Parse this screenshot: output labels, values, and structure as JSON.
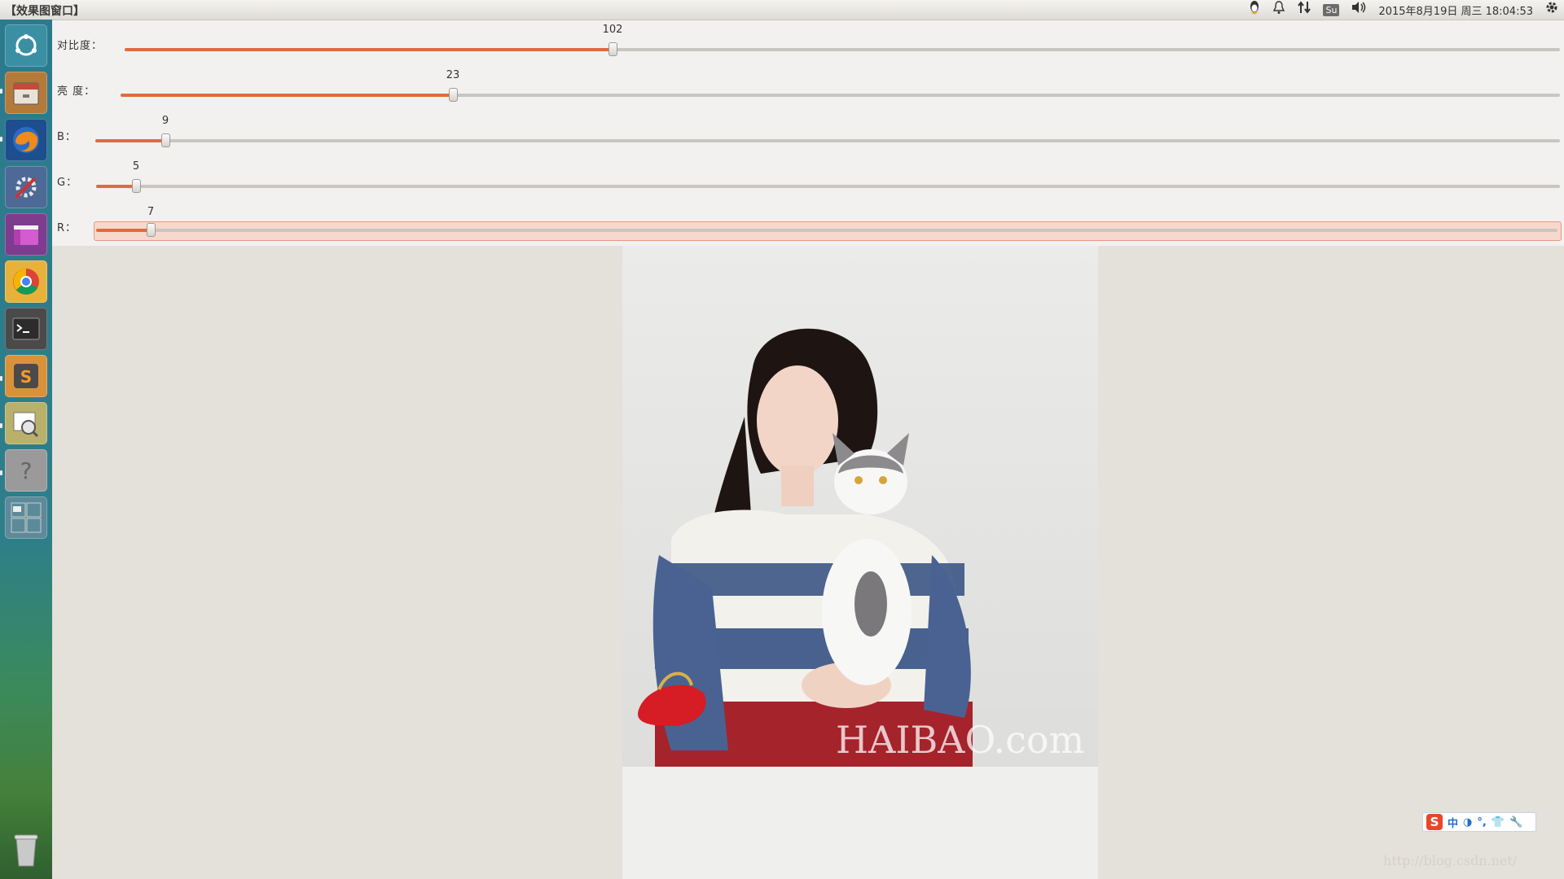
{
  "window": {
    "title": "【效果图窗口】"
  },
  "tray": {
    "items": [
      "qq-icon",
      "bell-icon",
      "network-arrows-icon",
      "su-icon",
      "volume-icon",
      "gear-icon"
    ],
    "su_label": "Su",
    "clock": "2015年8月19日 周三 18:04:53"
  },
  "launcher": {
    "items": [
      {
        "name": "dash-home",
        "color": "#3a8fa3"
      },
      {
        "name": "files",
        "color": "#b47a3a"
      },
      {
        "name": "firefox",
        "color": "#e56a1b"
      },
      {
        "name": "system-settings",
        "color": "#4d6a96"
      },
      {
        "name": "app-purple",
        "color": "#a23d9c"
      },
      {
        "name": "chrome",
        "color": "#e8b23a"
      },
      {
        "name": "terminal",
        "color": "#3a3a3a"
      },
      {
        "name": "sublime-text",
        "color": "#d9923a"
      },
      {
        "name": "image-viewer",
        "color": "#b9b06b"
      },
      {
        "name": "help",
        "color": "#8b8b8b"
      },
      {
        "name": "workspace-switcher",
        "color": "#5c8a9a"
      }
    ],
    "trash": "trash-icon"
  },
  "sliders": [
    {
      "label": "对比度：",
      "value": "102",
      "fraction": 0.34
    },
    {
      "label": "亮  度：",
      "value": "23",
      "fraction": 0.23
    },
    {
      "label": "B：",
      "value": "9",
      "fraction": 0.05
    },
    {
      "label": "G：",
      "value": "5",
      "fraction": 0.03
    },
    {
      "label": "R：",
      "value": "7",
      "fraction": 0.04,
      "focused": true
    }
  ],
  "ime": {
    "labels": [
      "中",
      "◑",
      "°,",
      "👕",
      "🔧"
    ]
  },
  "image": {
    "watermark": "HAIBAO.com"
  },
  "page_watermark": "http://blog.csdn.net/",
  "colors": {
    "slider_fill": "#e06b3e",
    "focus_bg": "#f8d8cc",
    "panel_bg": "#f2f1f0"
  }
}
